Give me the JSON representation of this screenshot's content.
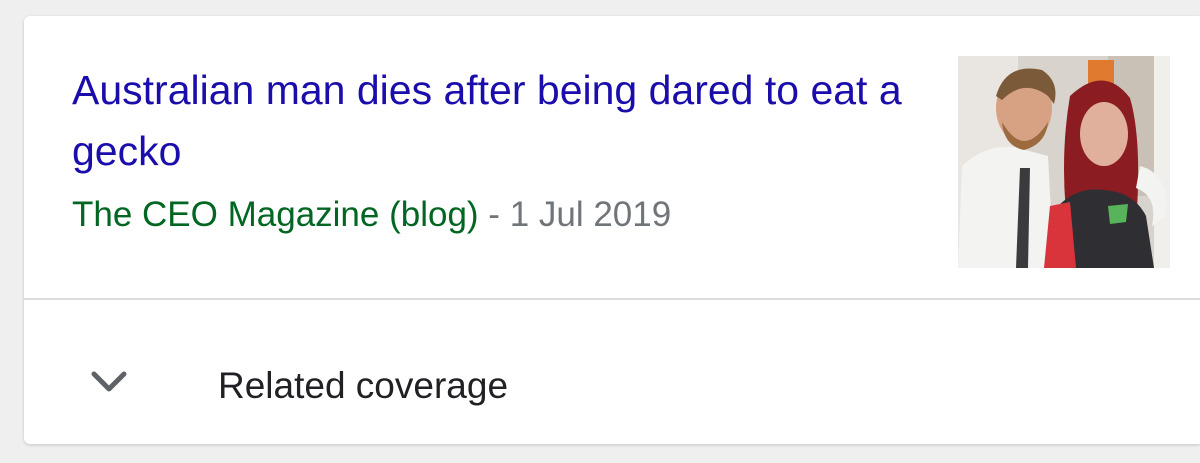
{
  "article": {
    "headline": "Australian man dies after being dared to eat a gecko",
    "source": "The CEO Magazine (blog)",
    "separator": " - ",
    "date": "1 Jul 2019",
    "thumbnail_icon": "news-photo-thumbnail"
  },
  "related": {
    "label": "Related coverage",
    "icon": "chevron-down-icon"
  },
  "colors": {
    "headline": "#1a0dab",
    "source": "#006621",
    "date": "#70757a",
    "background": "#efefef"
  }
}
